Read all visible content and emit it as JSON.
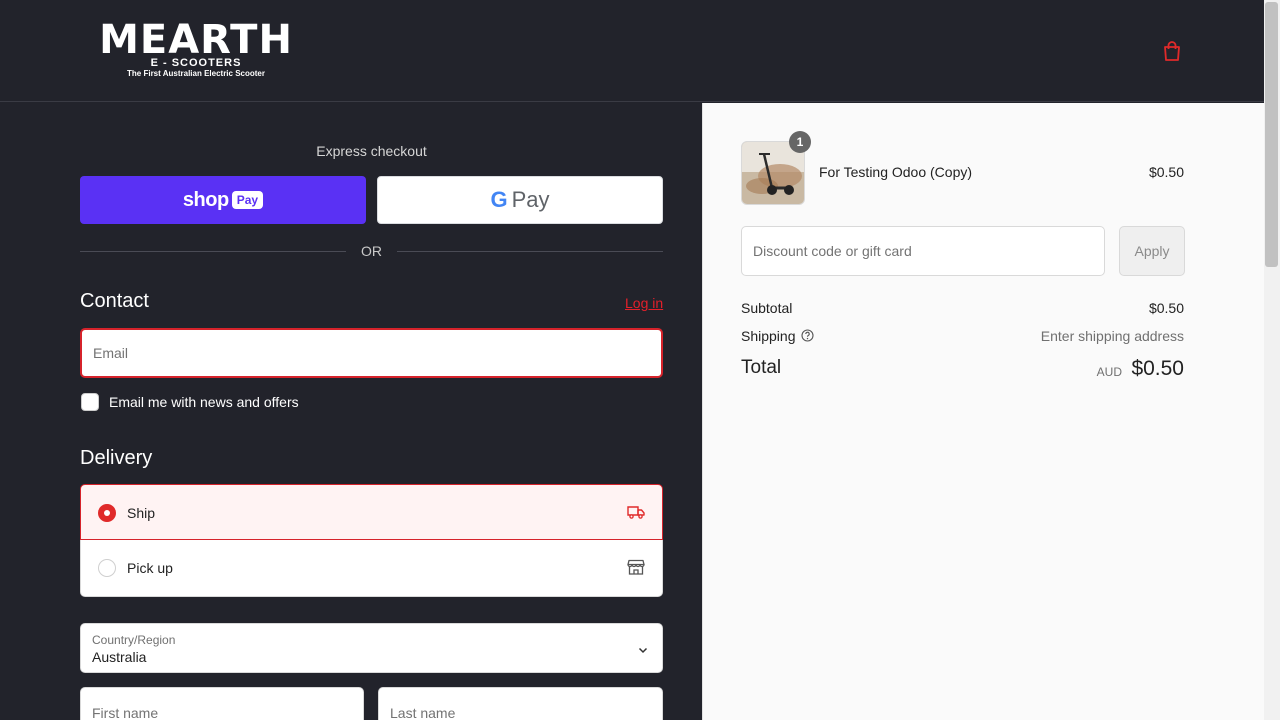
{
  "header": {
    "logo_main": "MEARTH",
    "logo_sub": "E - SCOOTERS",
    "logo_tag": "The First Australian Electric Scooter",
    "cart_icon": "shopping-bag-icon",
    "accent": "#e02a2a"
  },
  "express": {
    "label": "Express checkout",
    "shop_pay_text": "shop",
    "shop_pay_pill": "Pay",
    "gpay_g": "G",
    "gpay_pay": "Pay",
    "or": "OR"
  },
  "contact": {
    "title": "Contact",
    "login": "Log in",
    "email_placeholder": "Email",
    "newsletter_label": "Email me with news and offers"
  },
  "delivery": {
    "title": "Delivery",
    "options": [
      {
        "label": "Ship",
        "selected": true,
        "icon": "truck-icon"
      },
      {
        "label": "Pick up",
        "selected": false,
        "icon": "store-icon"
      }
    ],
    "country_label": "Country/Region",
    "country_value": "Australia",
    "first_name_placeholder": "First name",
    "last_name_placeholder": "Last name"
  },
  "summary": {
    "product": {
      "name": "For Testing Odoo (Copy)",
      "price": "$0.50",
      "quantity": "1"
    },
    "discount_placeholder": "Discount code or gift card",
    "apply": "Apply",
    "subtotal_label": "Subtotal",
    "subtotal_value": "$0.50",
    "shipping_label": "Shipping",
    "shipping_value": "Enter shipping address",
    "total_label": "Total",
    "total_currency": "AUD",
    "total_value": "$0.50"
  }
}
